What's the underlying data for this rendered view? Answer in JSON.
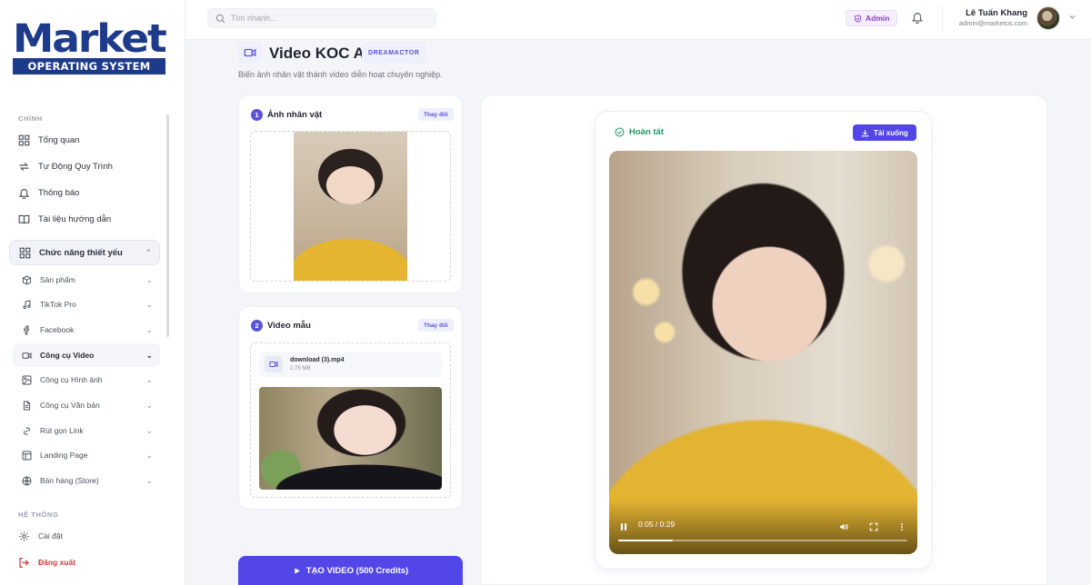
{
  "brand": {
    "logo_main": "Market",
    "logo_sub": "OPERATING SYSTEM"
  },
  "sidebar": {
    "section_main": "CHÍNH",
    "items": [
      {
        "label": "Tổng quan",
        "icon": "grid-icon"
      },
      {
        "label": "Tự Động Quy Trình",
        "icon": "repeat-icon"
      },
      {
        "label": "Thông báo",
        "icon": "bell-icon"
      },
      {
        "label": "Tài liệu hướng dẫn",
        "icon": "book-icon"
      }
    ],
    "group": {
      "label": "Chức năng thiết yếu",
      "icon": "grid-icon"
    },
    "sub_items": [
      {
        "label": "Sản phẩm",
        "icon": "box-icon"
      },
      {
        "label": "TikTok Pro",
        "icon": "music-icon"
      },
      {
        "label": "Facebook",
        "icon": "facebook-icon"
      },
      {
        "label": "Công cụ Video",
        "icon": "video-icon"
      },
      {
        "label": "Công cụ Hình ảnh",
        "icon": "image-icon"
      },
      {
        "label": "Công cụ Văn bản",
        "icon": "document-icon"
      },
      {
        "label": "Rút gọn Link",
        "icon": "link-icon"
      },
      {
        "label": "Landing Page",
        "icon": "layout-icon"
      },
      {
        "label": "Bán hàng (Store)",
        "icon": "globe-icon"
      }
    ],
    "section_system": "HỆ THỐNG",
    "settings": "Cài đặt",
    "logout": "Đăng xuất"
  },
  "topbar": {
    "search_placeholder": "Tìm nhanh...",
    "role_badge": "Admin",
    "user_name": "Lê Tuấn Khang",
    "user_email": "admin@marketos.com"
  },
  "page": {
    "title": "Video KOC AI",
    "tag": "DREAMACTOR",
    "subtitle": "Biến ảnh nhân vật thành video diễn hoạt chuyên nghiệp."
  },
  "step1": {
    "number": "1",
    "title": "Ảnh nhân vật",
    "change": "Thay đổi"
  },
  "step2": {
    "number": "2",
    "title": "Video mẫu",
    "change": "Thay đổi",
    "file_name": "download (3).mp4",
    "file_size": "2.75 MB"
  },
  "cta": {
    "label": "TẠO VIDEO (500 Credits)"
  },
  "result": {
    "status": "Hoàn tất",
    "download": "Tải xuống",
    "time": "0:05 / 0:29",
    "progress": 0.19
  },
  "colors": {
    "accent": "#5346e8",
    "success": "#1f9a62",
    "danger": "#d13b3b",
    "brand": "#1e3a8a"
  }
}
